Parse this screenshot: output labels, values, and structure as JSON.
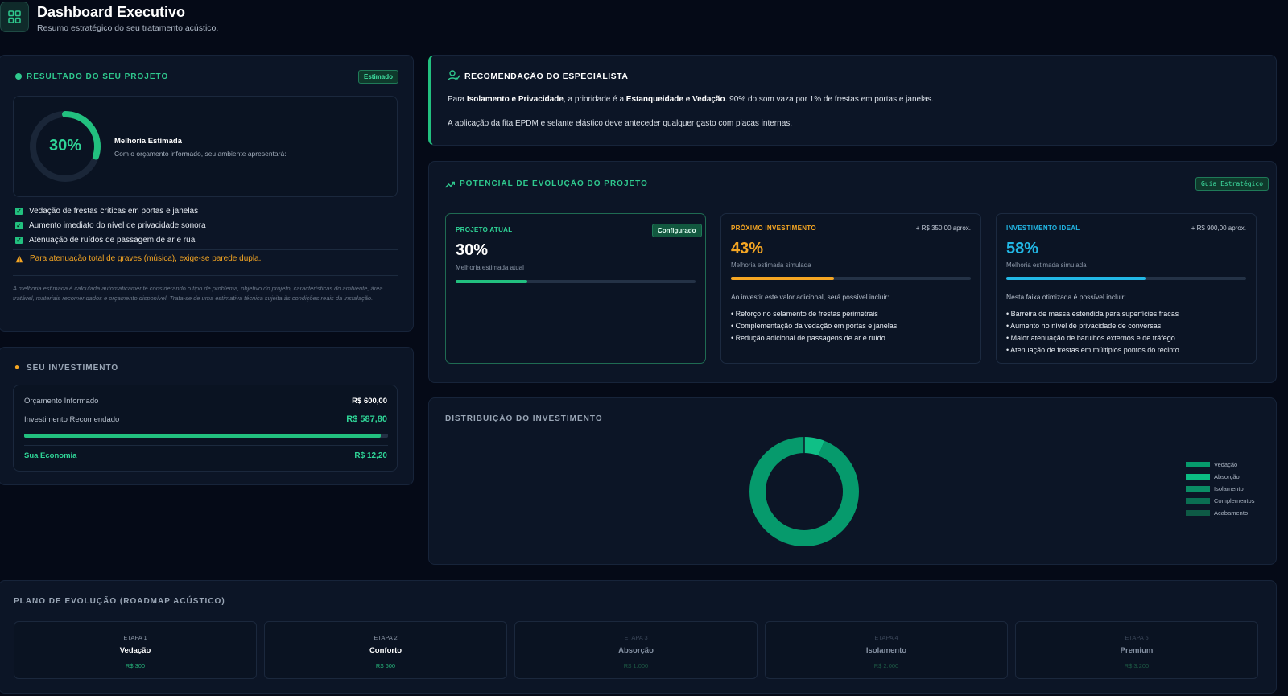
{
  "header": {
    "title": "Dashboard Executivo",
    "subtitle": "Resumo estratégico do seu tratamento acústico."
  },
  "result": {
    "title": "RESULTADO DO SEU PROJETO",
    "badge": "Estimado",
    "percent": "30%",
    "percent_value": 0.3,
    "improvement_title": "Melhoria Estimada",
    "improvement_text": "Com o orçamento informado, seu ambiente apresentará:",
    "items": [
      "Vedação de frestas críticas em portas e janelas",
      "Aumento imediato do nível de privacidade sonora",
      "Atenuação de ruídos de passagem de ar e rua"
    ],
    "warning": "Para atenuação total de graves (música), exige-se parede dupla.",
    "footnote": "A melhoria estimada é calculada automaticamente considerando o tipo de problema, objetivo do projeto, características do ambiente, área tratável, materiais recomendados e orçamento disponível. Trata-se de uma estimativa técnica sujeita às condições reais da instalação."
  },
  "investment": {
    "title": "SEU INVESTIMENTO",
    "budget_label": "Orçamento Informado",
    "budget_value": "R$ 600,00",
    "recommended_label": "Investimento Recomendado",
    "recommended_value": "R$ 587,80",
    "ratio": 0.98,
    "savings_label": "Sua Economia",
    "savings_value": "R$ 12,20"
  },
  "recommendation": {
    "title": "RECOMENDAÇÃO DO ESPECIALISTA",
    "p1_a": "Para ",
    "p1_b": "Isolamento e Privacidade",
    "p1_c": ", a prioridade é a ",
    "p1_d": "Estanqueidade e Vedação",
    "p1_e": ". 90% do som vaza por 1% de frestas em portas e janelas.",
    "p2": "A aplicação da fita EPDM e selante elástico deve anteceder qualquer gasto com placas internas."
  },
  "evolution": {
    "title": "POTENCIAL DE EVOLUÇÃO DO PROJETO",
    "badge": "Guia Estratégico",
    "current": {
      "label": "PROJETO ATUAL",
      "badge": "Configurado",
      "percent": "30%",
      "sub": "Melhoria estimada atual",
      "progress": 0.3
    },
    "next": {
      "label": "PRÓXIMO INVESTIMENTO",
      "price": "+ R$ 350,00 aprox.",
      "percent": "43%",
      "sub": "Melhoria estimada simulada",
      "progress": 0.43,
      "intro": "Ao investir este valor adicional, será possível incluir:",
      "items": [
        "Reforço no selamento de frestas perimetrais",
        "Complementação da vedação em portas e janelas",
        "Redução adicional de passagens de ar e ruído"
      ]
    },
    "ideal": {
      "label": "INVESTIMENTO IDEAL",
      "price": "+ R$ 900,00 aprox.",
      "percent": "58%",
      "sub": "Melhoria estimada simulada",
      "progress": 0.58,
      "intro": "Nesta faixa otimizada é possível incluir:",
      "items": [
        "Barreira de massa estendida para superfícies fracas",
        "Aumento no nível de privacidade de conversas",
        "Maior atenuação de barulhos externos e de tráfego",
        "Atenuação de frestas em múltiplos pontos do recinto"
      ]
    }
  },
  "distribution": {
    "title": "DISTRIBUIÇÃO DO INVESTIMENTO"
  },
  "chart_data": {
    "type": "pie",
    "donut": true,
    "categories": [
      "Vedação",
      "Absorção",
      "Isolamento",
      "Complementos",
      "Acabamento"
    ],
    "values": [
      94,
      0,
      0,
      0,
      6
    ],
    "colors": [
      "#069a6c",
      "#0bbd84",
      "#0a8d65",
      "#0a6e52",
      "#0e5a45"
    ],
    "legend_position": "right"
  },
  "roadmap": {
    "title": "PLANO DE EVOLUÇÃO (ROADMAP ACÚSTICO)",
    "stages": [
      {
        "step": "ETAPA 1",
        "name": "Vedação",
        "price": "R$ 300"
      },
      {
        "step": "ETAPA 2",
        "name": "Conforto",
        "price": "R$ 600"
      },
      {
        "step": "ETAPA 3",
        "name": "Absorção",
        "price": "R$ 1.000"
      },
      {
        "step": "ETAPA 4",
        "name": "Isolamento",
        "price": "R$ 2.000"
      },
      {
        "step": "ETAPA 5",
        "name": "Premium",
        "price": "R$ 3.200"
      }
    ]
  },
  "colors": {
    "accent": "#22c07f",
    "orange": "#f5a623",
    "cyan": "#22b8e6",
    "background": "#050a17"
  }
}
